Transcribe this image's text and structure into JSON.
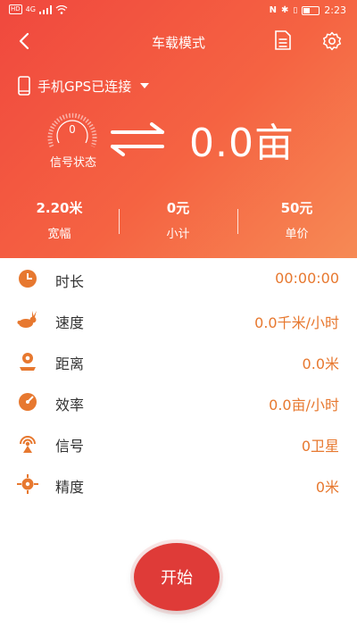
{
  "status_bar": {
    "left": [
      "HD",
      "4G"
    ],
    "right_time": "2:23"
  },
  "nav": {
    "title": "车载模式"
  },
  "gps": {
    "status_text": "手机GPS已连接"
  },
  "signal": {
    "value": "0",
    "label": "信号状态"
  },
  "area": {
    "value": "0.0亩"
  },
  "stats": [
    {
      "value": "2.20米",
      "label": "宽幅"
    },
    {
      "value": "0元",
      "label": "小计"
    },
    {
      "value": "50元",
      "label": "单价"
    }
  ],
  "metrics": [
    {
      "icon": "clock-icon",
      "label": "时长",
      "value": "00:00:00"
    },
    {
      "icon": "rabbit-icon",
      "label": "速度",
      "value": "0.0千米/小时"
    },
    {
      "icon": "distance-icon",
      "label": "距离",
      "value": "0.0米"
    },
    {
      "icon": "efficiency-icon",
      "label": "效率",
      "value": "0.0亩/小时"
    },
    {
      "icon": "satellite-signal-icon",
      "label": "信号",
      "value": "0卫星"
    },
    {
      "icon": "crosshair-icon",
      "label": "精度",
      "value": "0米"
    }
  ],
  "start_button": {
    "label": "开始"
  },
  "colors": {
    "header_start": "#f0483e",
    "header_end": "#f68a55",
    "accent": "#e7782f",
    "button": "#df3b38"
  }
}
